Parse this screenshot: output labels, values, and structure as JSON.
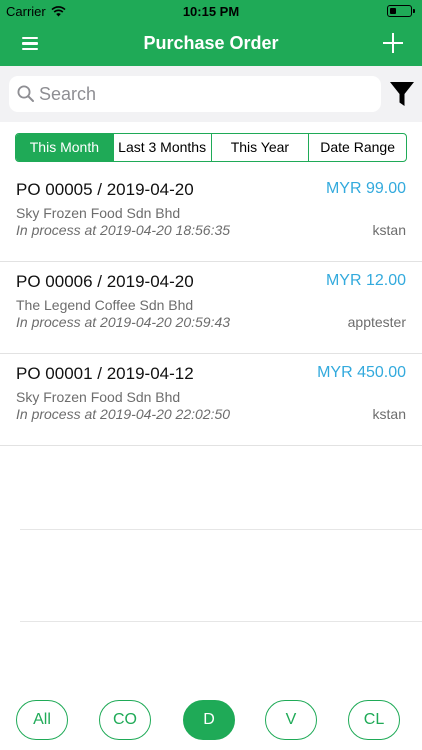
{
  "status_bar": {
    "carrier": "Carrier",
    "time": "10:15 PM",
    "battery_level": 0.35
  },
  "nav": {
    "title": "Purchase Order",
    "left_icon": "menu-icon",
    "right_icon": "plus-icon"
  },
  "search": {
    "placeholder": "Search",
    "value": ""
  },
  "filter_icon": "filter-icon",
  "segments": [
    {
      "label": "This Month",
      "active": true
    },
    {
      "label": "Last 3 Months",
      "active": false
    },
    {
      "label": "This Year",
      "active": false
    },
    {
      "label": "Date Range",
      "active": false
    }
  ],
  "orders": [
    {
      "title": "PO 00005 / 2019-04-20",
      "amount": "MYR 99.00",
      "company": "Sky Frozen Food Sdn Bhd",
      "status": "In process at 2019-04-20 18:56:35",
      "user": "kstan"
    },
    {
      "title": "PO 00006 / 2019-04-20",
      "amount": "MYR 12.00",
      "company": "The Legend Coffee Sdn Bhd",
      "status": "In process at 2019-04-20 20:59:43",
      "user": "apptester"
    },
    {
      "title": "PO 00001 / 2019-04-12",
      "amount": "MYR 450.00",
      "company": "Sky Frozen Food Sdn Bhd",
      "status": "In process at 2019-04-20 22:02:50",
      "user": "kstan"
    }
  ],
  "bottom_buttons": [
    {
      "label": "All",
      "active": false
    },
    {
      "label": "CO",
      "active": false
    },
    {
      "label": "D",
      "active": true
    },
    {
      "label": "V",
      "active": false
    },
    {
      "label": "CL",
      "active": false
    }
  ],
  "colors": {
    "primary": "#1faa57",
    "amount": "#33aadd",
    "secondary_text": "#6d6d6d"
  }
}
